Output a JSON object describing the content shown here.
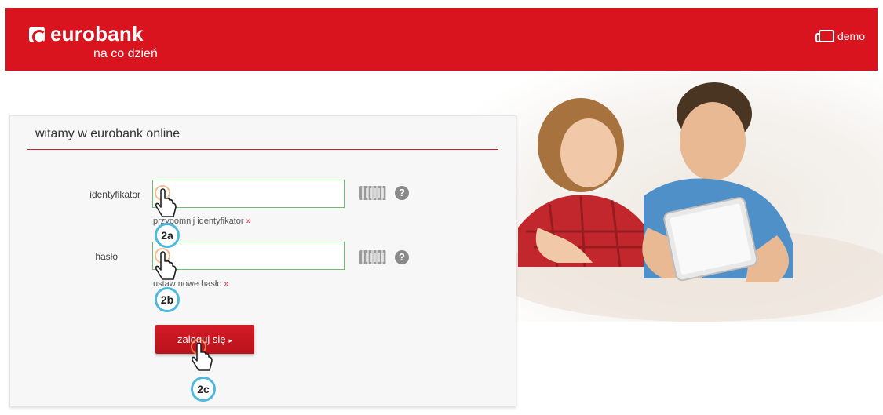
{
  "header": {
    "logo_name": "eurobank",
    "logo_tagline": "na co dzień",
    "demo_label": "demo",
    "background_color": "#d9141f"
  },
  "login_panel": {
    "title": "witamy w eurobank online",
    "identifier": {
      "label": "identyfikator",
      "value": "",
      "link_text": "przypomnij identyfikator",
      "link_arrow": "»"
    },
    "password": {
      "label": "hasło",
      "value": "",
      "link_text": "ustaw nowe hasło",
      "link_arrow": "»"
    },
    "help_glyph": "?",
    "login_button": {
      "label": "zaloguj się",
      "caret": "▸"
    }
  },
  "annotations": {
    "step_identifier": "2a",
    "step_password": "2b",
    "step_login": "2c",
    "badge_color": "#4fb8df"
  },
  "icons": {
    "logo": "eurobank-logo-icon",
    "demo": "demo-tablet-icon",
    "keyboard": "virtual-keyboard-icon",
    "help": "help-question-icon",
    "pointer": "hand-pointer-icon"
  }
}
